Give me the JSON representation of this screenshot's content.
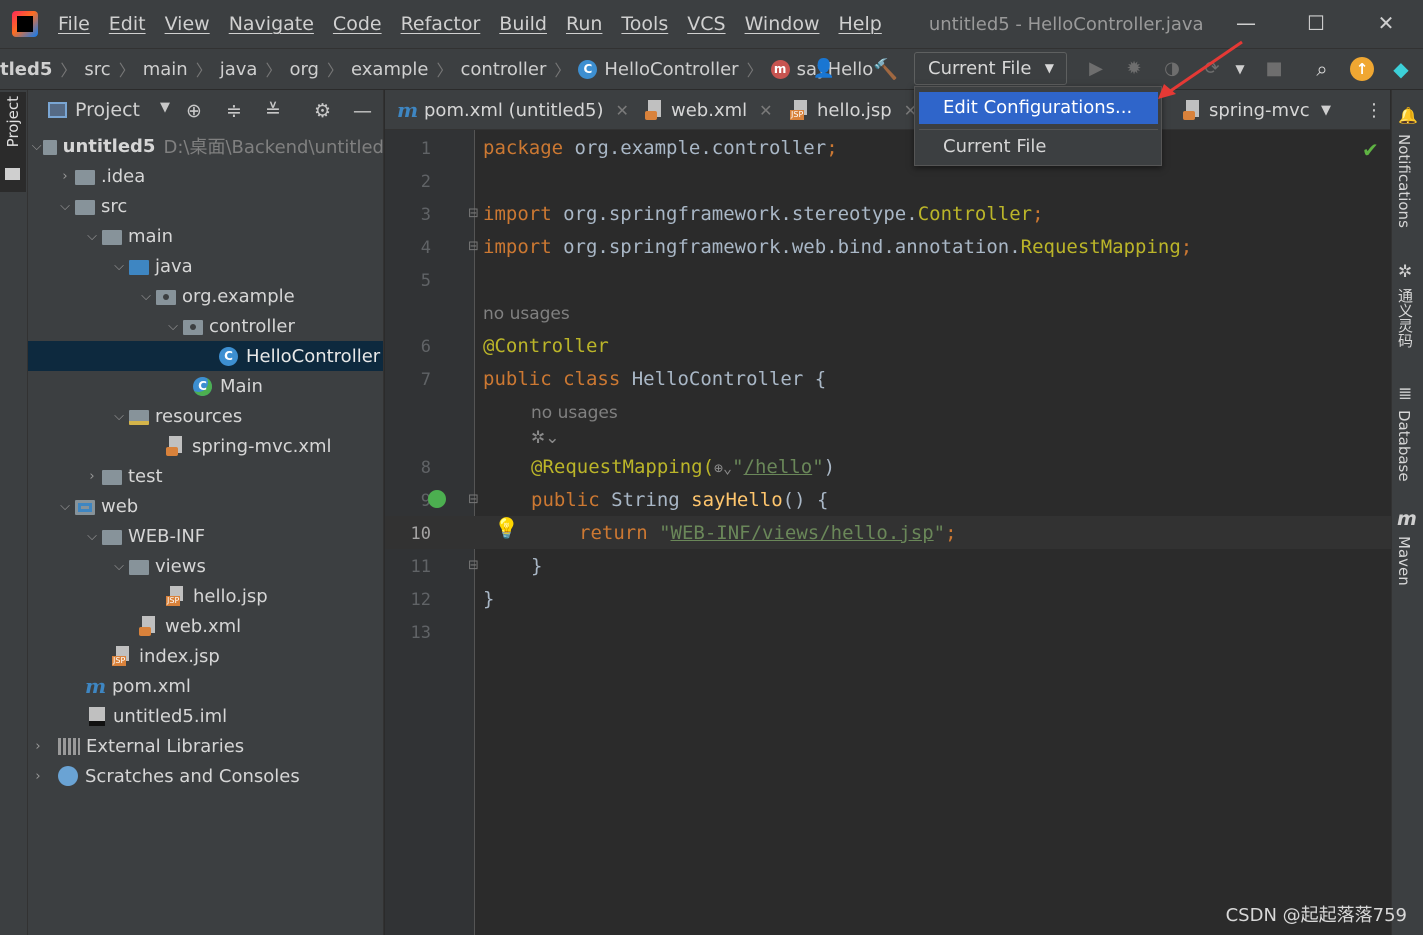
{
  "app": {
    "window_title": "untitled5 - HelloController.java",
    "menu": [
      "File",
      "Edit",
      "View",
      "Navigate",
      "Code",
      "Refactor",
      "Build",
      "Run",
      "Tools",
      "VCS",
      "Window",
      "Help"
    ]
  },
  "breadcrumbs": [
    "tled5",
    "src",
    "main",
    "java",
    "org",
    "example",
    "controller",
    "HelloController",
    "sayHello"
  ],
  "run_config": {
    "selected": "Current File",
    "options": [
      "Edit Configurations...",
      "Current File"
    ]
  },
  "project_panel": {
    "title": "Project",
    "tree": [
      {
        "label": "untitled5",
        "hint": "D:\\桌面\\Backend\\untitled"
      },
      {
        "label": ".idea"
      },
      {
        "label": "src"
      },
      {
        "label": "main"
      },
      {
        "label": "java"
      },
      {
        "label": "org.example"
      },
      {
        "label": "controller"
      },
      {
        "label": "HelloController"
      },
      {
        "label": "Main"
      },
      {
        "label": "resources"
      },
      {
        "label": "spring-mvc.xml"
      },
      {
        "label": "test"
      },
      {
        "label": "web"
      },
      {
        "label": "WEB-INF"
      },
      {
        "label": "views"
      },
      {
        "label": "hello.jsp"
      },
      {
        "label": "web.xml"
      },
      {
        "label": "index.jsp"
      },
      {
        "label": "pom.xml"
      },
      {
        "label": "untitled5.iml"
      },
      {
        "label": "External Libraries"
      },
      {
        "label": "Scratches and Consoles"
      }
    ]
  },
  "left_stripe": {
    "project_tab": "Project"
  },
  "editor_tabs": [
    "pom.xml (untitled5)",
    "web.xml",
    "hello.jsp",
    "spring-mvc"
  ],
  "editor": {
    "line_numbers": [
      "1",
      "2",
      "3",
      "4",
      "5",
      "6",
      "7",
      "8",
      "9",
      "10",
      "11",
      "12",
      "13"
    ],
    "code": {
      "l1_kw": "package",
      "l1_rest": " org.example.controller",
      "l1_semi": ";",
      "l3_kw": "import",
      "l3_pkg": " org.springframework.stereotype.",
      "l3_cls": "Controller",
      "l3_semi": ";",
      "l4_kw": "import",
      "l4_pkg": " org.springframework.web.bind.annotation.",
      "l4_cls": "RequestMapping",
      "l4_semi": ";",
      "l6_ann": "@Controller",
      "l7_kw": "public class",
      "l7_rest": " HelloController {",
      "l8_ann": "@RequestMapping(",
      "l8_q1": "\"",
      "l8_path": "/hello",
      "l8_q2": "\"",
      "l8_close": ")",
      "l9_kw": "public",
      "l9_type": " String ",
      "l9_fn": "sayHello",
      "l9_rest": "() {",
      "l10_kw": "return",
      "l10_q1": " \"",
      "l10_path": "WEB-INF/views/hello.jsp",
      "l10_q2": "\"",
      "l10_semi": ";",
      "l11": "}",
      "l12": "}"
    },
    "hints": {
      "no_usages_class": "no usages",
      "no_usages_method": "no usages"
    }
  },
  "right_stripe": [
    "Notifications",
    "通义灵码",
    "Database",
    "Maven"
  ],
  "watermark": "CSDN @起起落落759",
  "colors": {
    "selection": "#2f65ca",
    "keyword": "#cc7832",
    "annotation": "#bbb529",
    "string": "#6a8759",
    "function": "#ffc66d"
  }
}
